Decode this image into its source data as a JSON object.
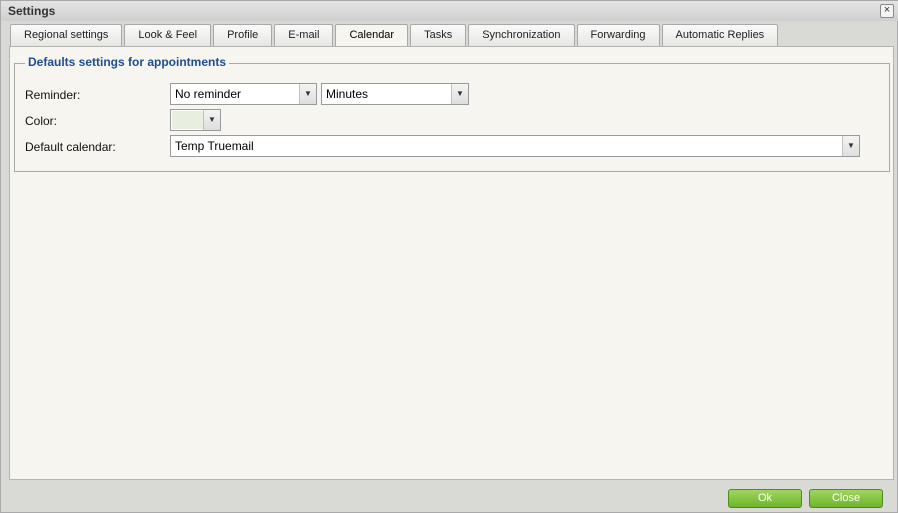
{
  "window": {
    "title": "Settings",
    "close_glyph": "×"
  },
  "tabs": [
    {
      "label": "Regional settings",
      "active": false
    },
    {
      "label": "Look & Feel",
      "active": false
    },
    {
      "label": "Profile",
      "active": false
    },
    {
      "label": "E-mail",
      "active": false
    },
    {
      "label": "Calendar",
      "active": true
    },
    {
      "label": "Tasks",
      "active": false
    },
    {
      "label": "Synchronization",
      "active": false
    },
    {
      "label": "Forwarding",
      "active": false
    },
    {
      "label": "Automatic Replies",
      "active": false
    }
  ],
  "appointments": {
    "legend": "Defaults settings for appointments",
    "reminder_label": "Reminder:",
    "reminder_value": "No reminder",
    "reminder_unit": "Minutes",
    "color_label": "Color:",
    "color_value": "#e8efe0",
    "default_calendar_label": "Default calendar:",
    "default_calendar_value": "Temp Truemail"
  },
  "buttons": {
    "ok": "Ok",
    "close": "Close"
  },
  "icons": {
    "dropdown": "chevron-down-icon",
    "close": "close-icon"
  }
}
